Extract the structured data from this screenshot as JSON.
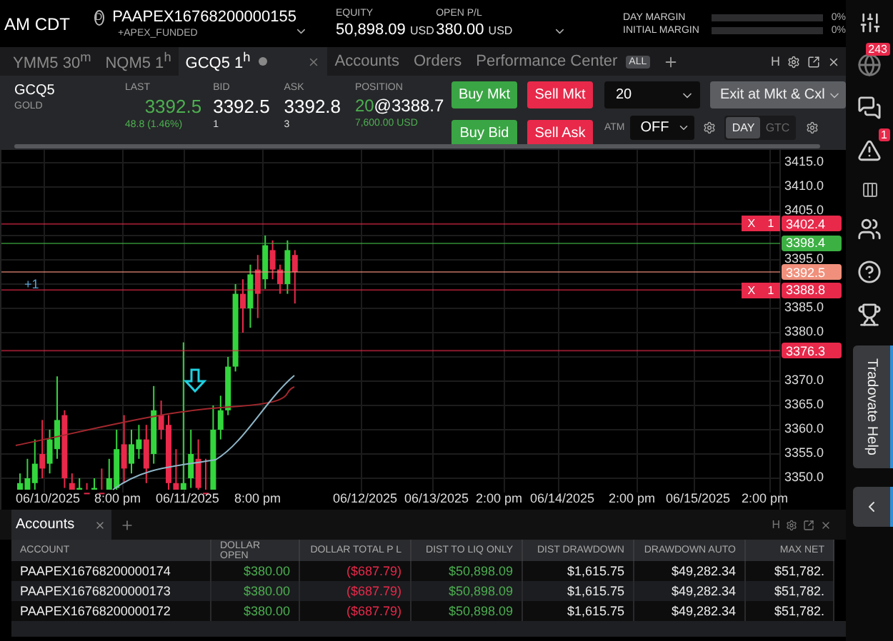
{
  "header": {
    "time_label": "AM CDT",
    "account_badge": "D",
    "account": "PAAPEX16768200000155",
    "account_sub": "+APEX_FUNDED",
    "equity": {
      "label": "EQUITY",
      "value": "50,898.09",
      "unit": "USD"
    },
    "open_pl": {
      "label": "OPEN P/L",
      "value": "380.00",
      "unit": "USD"
    },
    "margins": [
      {
        "label": "DAY MARGIN",
        "level": 0,
        "reading": "0%"
      },
      {
        "label": "INITIAL MARGIN",
        "level": 0,
        "reading": "0%"
      }
    ]
  },
  "tabs": [
    {
      "label": "YMM5 30$^{m}$",
      "selected": false
    },
    {
      "label": "NQM5 1$^{h}$",
      "selected": false
    },
    {
      "label": "GCQ5 1$^{h}$",
      "selected": true
    },
    {
      "label": "Accounts",
      "selected": false
    },
    {
      "label": "Orders",
      "selected": false
    },
    {
      "label": "Performance Center",
      "badge": "ALL",
      "selected": false
    }
  ],
  "tab_tools": {
    "hotkey": "H"
  },
  "quote": {
    "symbol": "GCQ5",
    "name": "GOLD",
    "last_label": "LAST",
    "last": "3392.5",
    "change": "48.8 (1.46%)",
    "bid_label": "BID",
    "bid": "3392.5",
    "bid_size": "1",
    "ask_label": "ASK",
    "ask": "3392.8",
    "ask_size": "3",
    "position_label": "POSITION",
    "position_qty": "20",
    "position_price": "@3388.7",
    "position_value": "7,600.00 USD"
  },
  "order_buttons": [
    {
      "label": "Buy Mkt",
      "kind": "buy"
    },
    {
      "label": "Sell Mkt",
      "kind": "sell"
    },
    {
      "label": "Buy Bid",
      "kind": "buy"
    },
    {
      "label": "Sell Ask",
      "kind": "sell"
    }
  ],
  "quantity": "20",
  "exit_button": "Exit at Mkt & Cxl",
  "atm_label": "ATM",
  "atm_value": "OFF",
  "time_in_force": [
    {
      "label": "DAY",
      "selected": true
    },
    {
      "label": "GTC",
      "selected": false
    }
  ],
  "chart": {
    "price_ticks": [
      "3415.0",
      "3410.0",
      "3405.0",
      "3395.0",
      "3385.0",
      "3380.0",
      "3370.0",
      "3365.0",
      "3360.0",
      "3355.0",
      "3350.0"
    ],
    "date_labels": [
      "06/10/2025",
      "8:00 pm",
      "06/11/2025",
      "8:00 pm",
      "06/12/2025",
      "06/13/2025",
      "2:00 pm",
      "06/14/2025",
      "2:00 pm",
      "06/15/2025",
      "2:00 pm"
    ],
    "price_lines": [
      {
        "price": "3402.4",
        "color": "#e8294a",
        "cancel": "X",
        "qty": "1"
      },
      {
        "price": "3398.4",
        "color": "#3cb043"
      },
      {
        "price": "3392.5",
        "color": "#f0907c"
      },
      {
        "price": "3388.8",
        "color": "#e8294a",
        "cancel": "X",
        "qty": "1",
        "position_label": "+1"
      },
      {
        "price": "3376.3",
        "color": "#e8294a"
      }
    ]
  },
  "accounts_panel": {
    "tab": "Accounts",
    "hotkey": "H",
    "columns": [
      {
        "label": "ACCOUNT",
        "kind": "text"
      },
      {
        "label": "DOLLAR OPEN",
        "kind": "gain"
      },
      {
        "label": "DOLLAR TOTAL P L",
        "kind": "loss"
      },
      {
        "label": "DIST TO LIQ ONLY",
        "kind": "gain"
      },
      {
        "label": "DIST DRAWDOWN",
        "kind": "plain"
      },
      {
        "label": "DRAWDOWN AUTO",
        "kind": "plain"
      },
      {
        "label": "MAX NET",
        "kind": "plain"
      }
    ],
    "rows": [
      [
        "PAAPEX16768200000174",
        "$380.00",
        "($687.79)",
        "$50,898.09",
        "$1,615.75",
        "$49,282.34",
        "$51,782."
      ],
      [
        "PAAPEX16768200000173",
        "$380.00",
        "($687.79)",
        "$50,898.09",
        "$1,615.75",
        "$49,282.34",
        "$51,782."
      ],
      [
        "PAAPEX16768200000172",
        "$380.00",
        "($687.79)",
        "$50,898.09",
        "$1,615.75",
        "$49,282.34",
        "$51,782."
      ]
    ]
  },
  "sidebar": {
    "badges": [
      "243",
      "1"
    ],
    "help_tab": "Tradovate Help"
  }
}
